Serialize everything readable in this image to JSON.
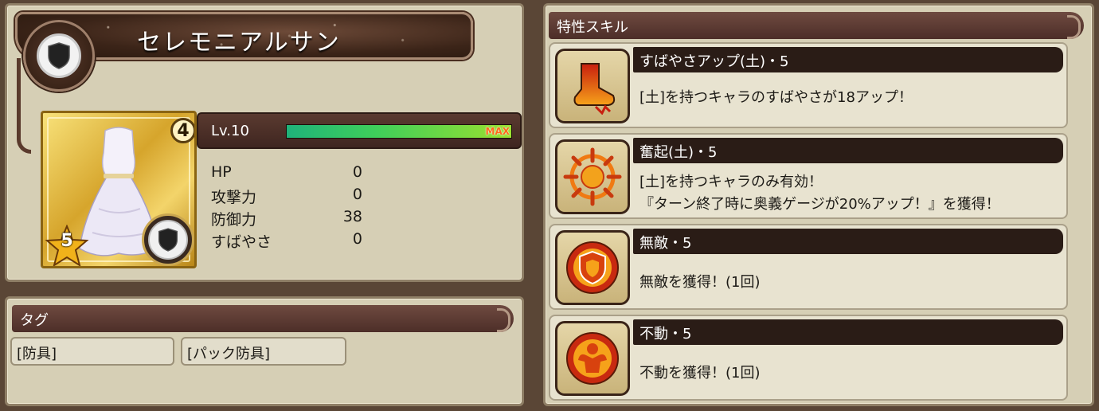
{
  "character": {
    "name": "セレモニアルサン",
    "type_icon": "shield-icon",
    "rarity": "4",
    "stars": "5",
    "level": "Lv.10",
    "xp_label": "MAX",
    "xp_progress": 1.0,
    "stats": [
      {
        "label": "HP",
        "value": "0"
      },
      {
        "label": "攻撃力",
        "value": "0"
      },
      {
        "label": "防御力",
        "value": "38"
      },
      {
        "label": "すばやさ",
        "value": "0"
      }
    ]
  },
  "tags": {
    "header": "タグ",
    "items": [
      "[防具]",
      "[パック防具]"
    ]
  },
  "skills": {
    "header": "特性スキル",
    "items": [
      {
        "name": "すばやさアップ(土)・5",
        "desc1": "[土]を持つキャラのすばやさが18アップ！",
        "desc2": "",
        "icon": "boot-icon"
      },
      {
        "name": "奮起(土)・5",
        "desc1": "[土]を持つキャラのみ有効！",
        "desc2": "『ターン終了時に奥義ゲージが20%アップ！』を獲得！",
        "icon": "burst-icon"
      },
      {
        "name": "無敵・5",
        "desc1": "無敵を獲得！(1回)",
        "desc2": "",
        "icon": "invincible-icon"
      },
      {
        "name": "不動・5",
        "desc1": "不動を獲得！(1回)",
        "desc2": "",
        "icon": "immovable-icon"
      }
    ]
  },
  "colors": {
    "panel": "#d6cfb5",
    "header_bar": "#5a3a30",
    "xp_fill": "#3fcf5a",
    "skill_icon_orange": "#f07a12"
  }
}
